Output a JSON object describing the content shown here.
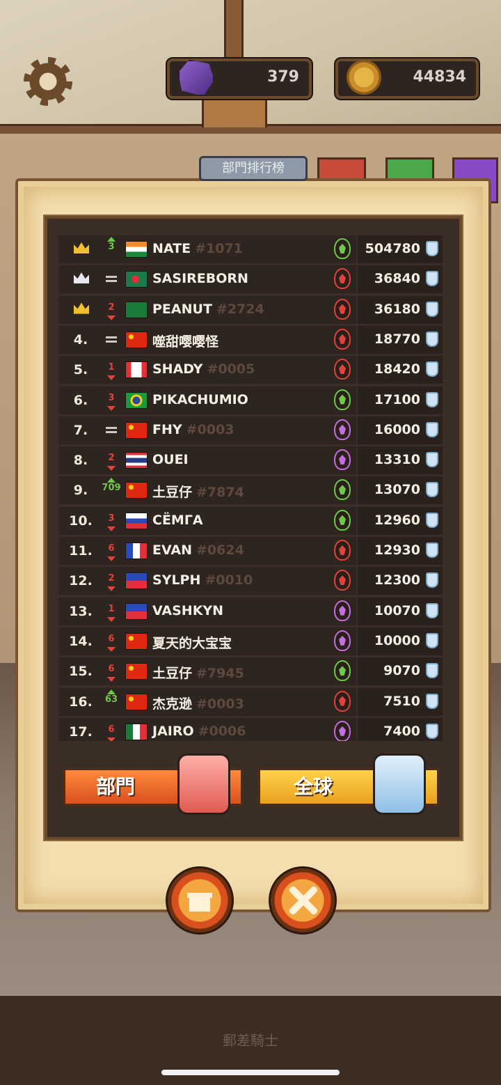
{
  "top_bar": {
    "gems": "379",
    "coins": "44834"
  },
  "tab": {
    "label": "部門排行榜"
  },
  "leaderboard": [
    {
      "rank": "",
      "crown": "gold",
      "move": "up",
      "move_num": "3",
      "flag": "in",
      "name": "NATE",
      "tag": "#1071",
      "faction": "green",
      "score": "504780"
    },
    {
      "rank": "",
      "crown": "silver",
      "move": "same",
      "move_num": "",
      "flag": "bd",
      "name": "SASIREBORN",
      "tag": "",
      "faction": "red",
      "score": "36840"
    },
    {
      "rank": "",
      "crown": "gold",
      "move": "down",
      "move_num": "2",
      "flag": "sa",
      "name": "PEANUT",
      "tag": "#2724",
      "faction": "red",
      "score": "36180"
    },
    {
      "rank": "4.",
      "crown": "",
      "move": "same",
      "move_num": "",
      "flag": "cn",
      "name": "噬甜嘤嘤怪",
      "tag": "",
      "faction": "red",
      "score": "18770"
    },
    {
      "rank": "5.",
      "crown": "",
      "move": "down",
      "move_num": "1",
      "flag": "ca",
      "name": "SHADY",
      "tag": "#0005",
      "faction": "red",
      "score": "18420"
    },
    {
      "rank": "6.",
      "crown": "",
      "move": "down",
      "move_num": "3",
      "flag": "br",
      "name": "PIKACHUMIO",
      "tag": "",
      "faction": "green",
      "score": "17100"
    },
    {
      "rank": "7.",
      "crown": "",
      "move": "same",
      "move_num": "",
      "flag": "cn",
      "name": "FHY",
      "tag": "#0003",
      "faction": "purple",
      "score": "16000"
    },
    {
      "rank": "8.",
      "crown": "",
      "move": "down",
      "move_num": "2",
      "flag": "th",
      "name": "OUEI",
      "tag": "",
      "faction": "purple",
      "score": "13310"
    },
    {
      "rank": "9.",
      "crown": "",
      "move": "up",
      "move_num": "709",
      "flag": "cn",
      "name": "土豆仔",
      "tag": "#7874",
      "faction": "green",
      "score": "13070"
    },
    {
      "rank": "10.",
      "crown": "",
      "move": "down",
      "move_num": "3",
      "flag": "ru",
      "name": "СЁМГА",
      "tag": "",
      "faction": "green",
      "score": "12960"
    },
    {
      "rank": "11.",
      "crown": "",
      "move": "down",
      "move_num": "6",
      "flag": "fr",
      "name": "EVAN",
      "tag": "#0624",
      "faction": "red",
      "score": "12930"
    },
    {
      "rank": "12.",
      "crown": "",
      "move": "down",
      "move_num": "2",
      "flag": "ph",
      "name": "SYLPH",
      "tag": "#0010",
      "faction": "red",
      "score": "12300"
    },
    {
      "rank": "13.",
      "crown": "",
      "move": "down",
      "move_num": "1",
      "flag": "ph",
      "name": "VASHKYN",
      "tag": "",
      "faction": "purple",
      "score": "10070"
    },
    {
      "rank": "14.",
      "crown": "",
      "move": "down",
      "move_num": "6",
      "flag": "cn",
      "name": "夏天的大宝宝",
      "tag": "",
      "faction": "purple",
      "score": "10000"
    },
    {
      "rank": "15.",
      "crown": "",
      "move": "down",
      "move_num": "6",
      "flag": "cn",
      "name": "土豆仔",
      "tag": "#7945",
      "faction": "green",
      "score": "9070"
    },
    {
      "rank": "16.",
      "crown": "",
      "move": "up",
      "move_num": "63",
      "flag": "cn",
      "name": "杰克逊",
      "tag": "#0003",
      "faction": "red",
      "score": "7510"
    },
    {
      "rank": "17.",
      "crown": "",
      "move": "down",
      "move_num": "6",
      "flag": "mx",
      "name": "JAIRO",
      "tag": "#0006",
      "faction": "purple",
      "score": "7400"
    }
  ],
  "buttons": {
    "department": "部門",
    "global": "全球"
  },
  "footer": {
    "title": "郵差騎士"
  }
}
